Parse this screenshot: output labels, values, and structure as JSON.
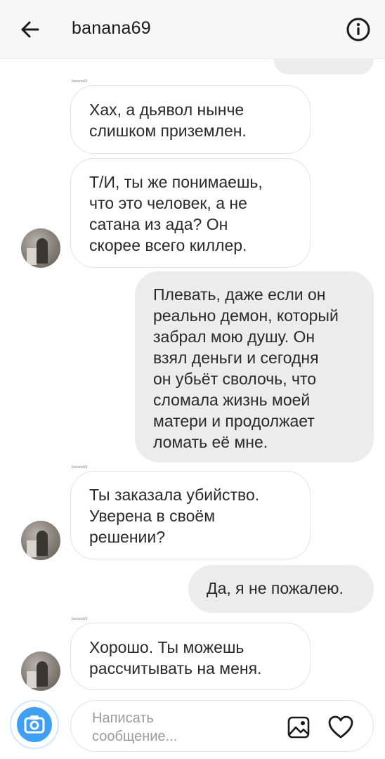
{
  "header": {
    "title": "banana69",
    "back_icon": "arrow-left-icon",
    "info_icon": "info-circle-icon"
  },
  "messages": [
    {
      "sender": "banana69",
      "text": "Хах, а дьявол нынче\nслишком приземлен.",
      "direction": "incoming"
    },
    {
      "text": "Т/И, ты же понимаешь,\nчто это человек, а не\nсатана из ада? Он\nскорее всего киллер.",
      "direction": "incoming"
    },
    {
      "text": "Плевать, даже если он\nреально демон, который\nзабрал мою душу. Он\nвзял деньги и сегодня\nон убьёт сволочь, что\nсломала жизнь моей\nматери и продолжает\nломать её мне.",
      "direction": "outgoing"
    },
    {
      "sender": "banana69",
      "text": "Ты заказала убийство.\nУверена в своём\nрешении?",
      "direction": "incoming"
    },
    {
      "text": "Да, я не пожалею.",
      "direction": "outgoing"
    },
    {
      "sender": "banana69",
      "text": "Хорошо. Ты можешь\nрассчитывать на меня.",
      "direction": "incoming"
    }
  ],
  "composer": {
    "placeholder": "Написать\nсообщение...",
    "camera_icon": "camera-icon",
    "gallery_icon": "image-icon",
    "like_icon": "heart-icon"
  },
  "colors": {
    "accent": "#3ea0f5",
    "incoming_bubble_border": "#e2e2e2",
    "outgoing_bubble": "#ececec",
    "header_bg": "#f7f7f7"
  }
}
